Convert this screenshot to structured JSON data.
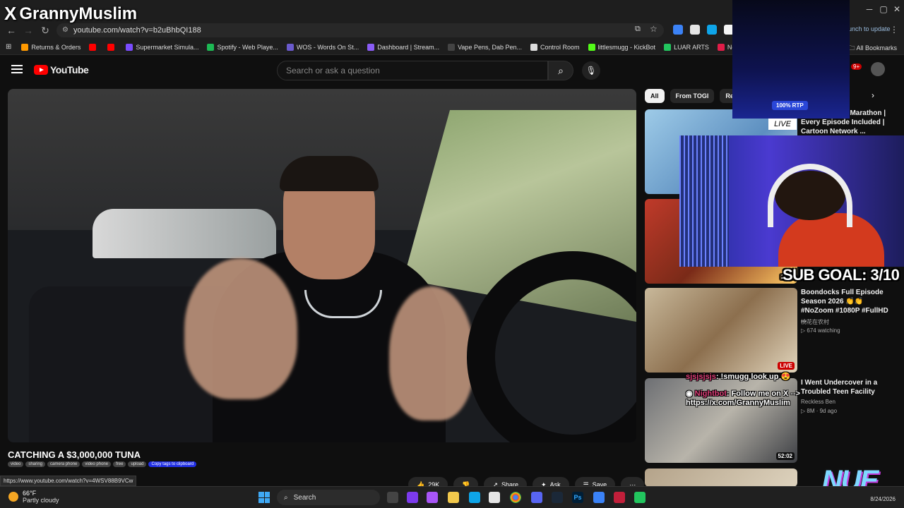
{
  "overlay": {
    "streamer_name": "GrannyMuslim",
    "x_glyph": "X",
    "rtp_badge": "100% RTP",
    "live_card": "LIVE",
    "sub_goal": "SUB GOAL: 3/10",
    "chat": [
      {
        "user": "sjsjsjsjs",
        "message": ": !smugg look up 😍"
      },
      {
        "user": "Nightbot",
        "message": ": Follow me on X -->"
      },
      {
        "user": "",
        "message": "https://x.com/GrannyMuslim"
      }
    ],
    "brand_logo_text": "NUE"
  },
  "browser": {
    "url": "youtube.com/watch?v=b2uBhbQI188",
    "relaunch_label": "aunch to update",
    "all_bookmarks": "All Bookmarks",
    "bookmarks": [
      {
        "label": "Returns & Orders",
        "color": "#ff9900"
      },
      {
        "label": "",
        "color": "#ff0000"
      },
      {
        "label": "",
        "color": "#ff0000"
      },
      {
        "label": "Supermarket Simula...",
        "color": "#7a4cff"
      },
      {
        "label": "Spotify - Web Playe...",
        "color": "#1db954"
      },
      {
        "label": "WOS - Words On St...",
        "color": "#6a5acd"
      },
      {
        "label": "Dashboard | Stream...",
        "color": "#8a5cf6"
      },
      {
        "label": "Vape Pens, Dab Pen...",
        "color": "#444444"
      },
      {
        "label": "Control Room",
        "color": "#dddddd"
      },
      {
        "label": "littlesmugg - KickBot",
        "color": "#53fc18"
      },
      {
        "label": "LUAR ARTS",
        "color": "#22c55e"
      },
      {
        "label": "New Project - Studio",
        "color": "#e11d48"
      }
    ],
    "status_url": "https://www.youtube.com/watch?v=4WSV88B9VCw"
  },
  "youtube": {
    "logo_text": "YouTube",
    "search_placeholder": "Search or ask a question",
    "notification_count": "9+",
    "video": {
      "title": "CATCHING A $3,000,000 TUNA",
      "tags": [
        "video",
        "sharing",
        "camera phone",
        "video phone",
        "free",
        "upload"
      ],
      "copy_tags_label": "Copy tags to clipboard",
      "actions": [
        {
          "name": "like",
          "label": "29K",
          "icon": "👍"
        },
        {
          "name": "dislike",
          "label": "",
          "icon": "👎"
        },
        {
          "name": "share",
          "label": "Share",
          "icon": "↗"
        },
        {
          "name": "ask",
          "label": "Ask",
          "icon": "✦"
        },
        {
          "name": "save",
          "label": "Save",
          "icon": "☰"
        },
        {
          "name": "more",
          "label": "",
          "icon": "⋯"
        }
      ]
    },
    "chips": [
      "All",
      "From TOGI",
      "Rela"
    ],
    "sidebar": [
      {
        "title": "...ull Season 6 Marathon | Every Episode Included | Cartoon Network ...",
        "channel": "",
        "meta": "",
        "badge": ""
      },
      {
        "title": "",
        "channel": "",
        "meta": "",
        "badge": "2:14"
      },
      {
        "title": "Boondocks Full Episode Season 2026 👏👏 #NoZoom #1080P #FullHD ...",
        "channel": "桃花在农村",
        "meta": "674 watching",
        "badge": "LIVE"
      },
      {
        "title": "I Went Undercover in a Troubled Teen Facility",
        "channel": "Reckless Ben",
        "meta": "8M · 9d ago",
        "badge": "52:02"
      }
    ]
  },
  "taskbar": {
    "weather_temp": "66°F",
    "weather_desc": "Partly cloudy",
    "search_label": "Search",
    "date": "8/24/2026"
  }
}
